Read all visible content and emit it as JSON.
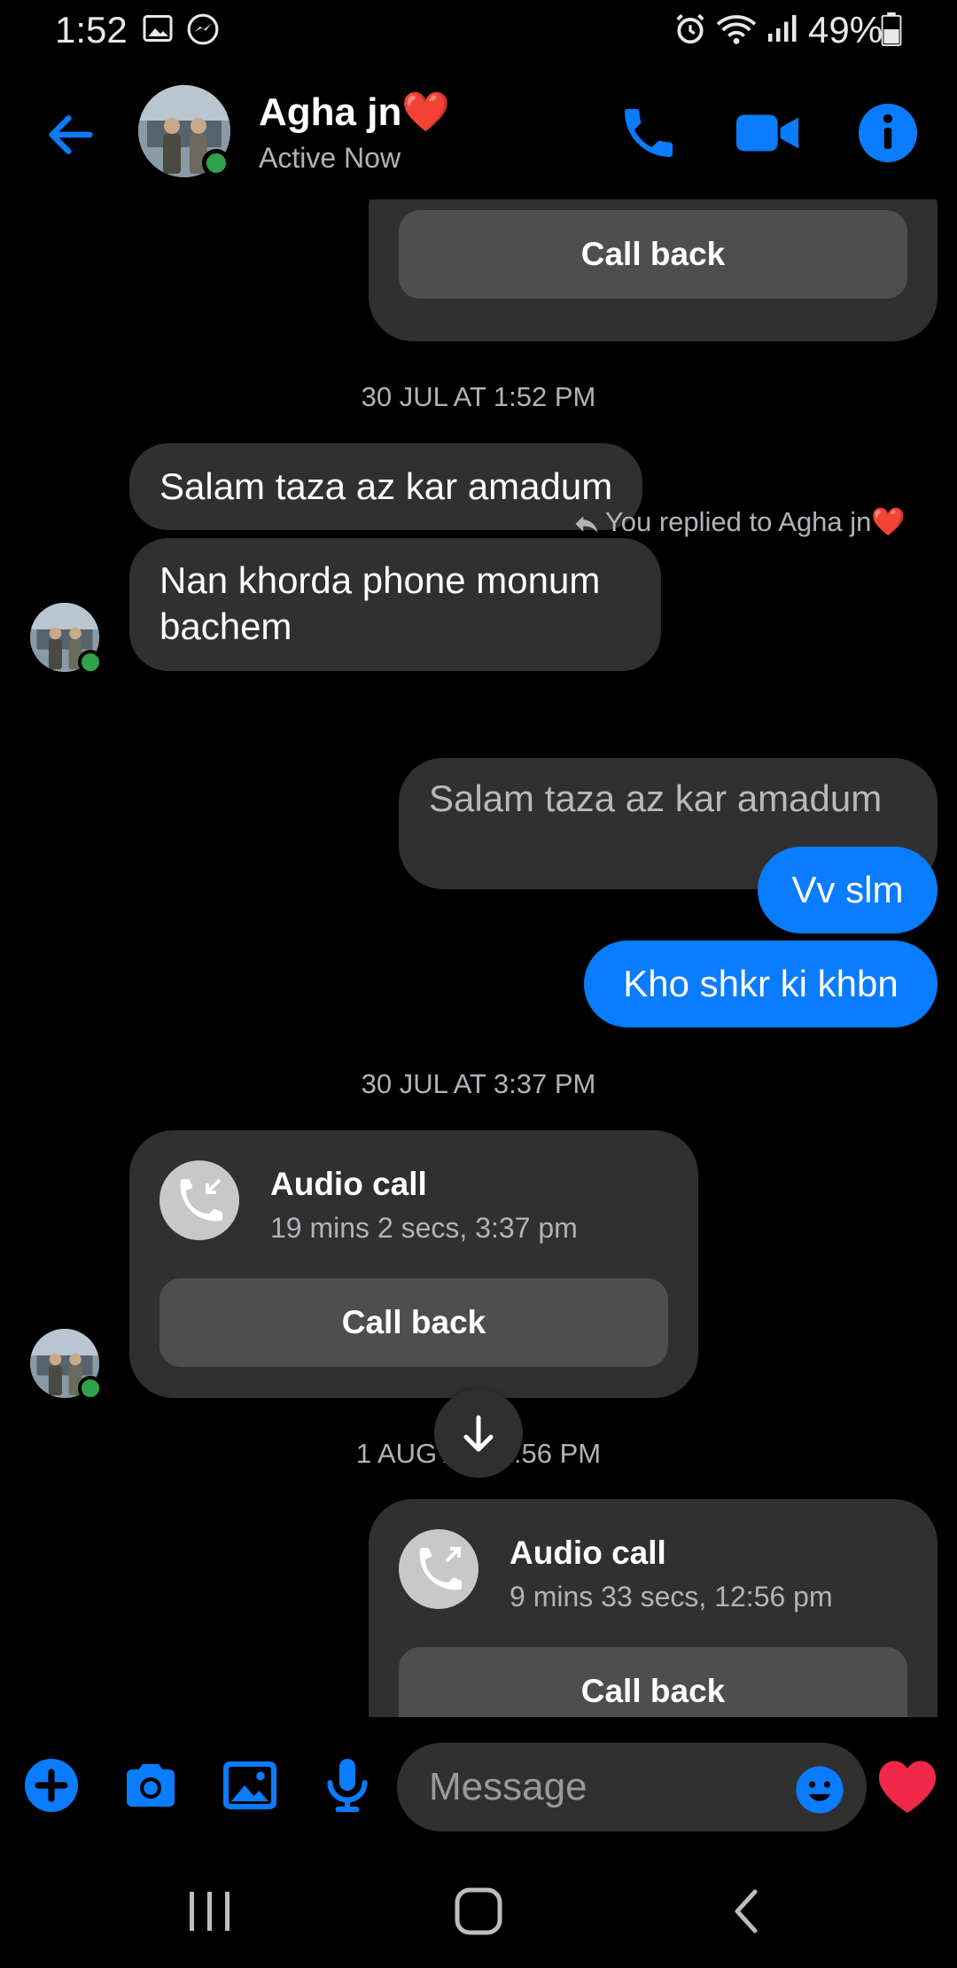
{
  "status_bar": {
    "time": "1:52",
    "battery": "49%",
    "icons": [
      "gallery-icon",
      "messenger-icon",
      "alarm-icon",
      "wifi-icon",
      "signal-icon",
      "battery-icon"
    ]
  },
  "header": {
    "contact_name": "Agha jn",
    "contact_emoji": "❤️",
    "status": "Active Now",
    "buttons": [
      "back-icon",
      "phone-icon",
      "video-icon",
      "info-icon"
    ]
  },
  "messages": {
    "top_card_callback": "Call back",
    "ts1": "30 JUL AT 1:52 PM",
    "in1": "Salam taza az kar amadum",
    "in2": "Nan khorda phone monum bachem",
    "reply_note": "You replied to Agha jn❤️",
    "quoted": "Salam taza az kar amadum",
    "out1": "Vv slm",
    "out2": "Kho shkr ki khbn",
    "ts2": "30 JUL AT 3:37 PM",
    "call1": {
      "title": "Audio call",
      "detail": "19 mins 2 secs, 3:37 pm",
      "callback": "Call back"
    },
    "ts3": "1 AUG AT 12:56 PM",
    "call2": {
      "title": "Audio call",
      "detail": "9 mins 33 secs, 12:56 pm",
      "callback": "Call back"
    }
  },
  "composer": {
    "placeholder": "Message",
    "buttons": [
      "plus-icon",
      "camera-icon",
      "image-icon",
      "mic-icon",
      "emoji-icon",
      "heart-icon"
    ]
  },
  "colors": {
    "accent": "#0a7cff",
    "bubble": "#303030",
    "online": "#31a24c"
  }
}
